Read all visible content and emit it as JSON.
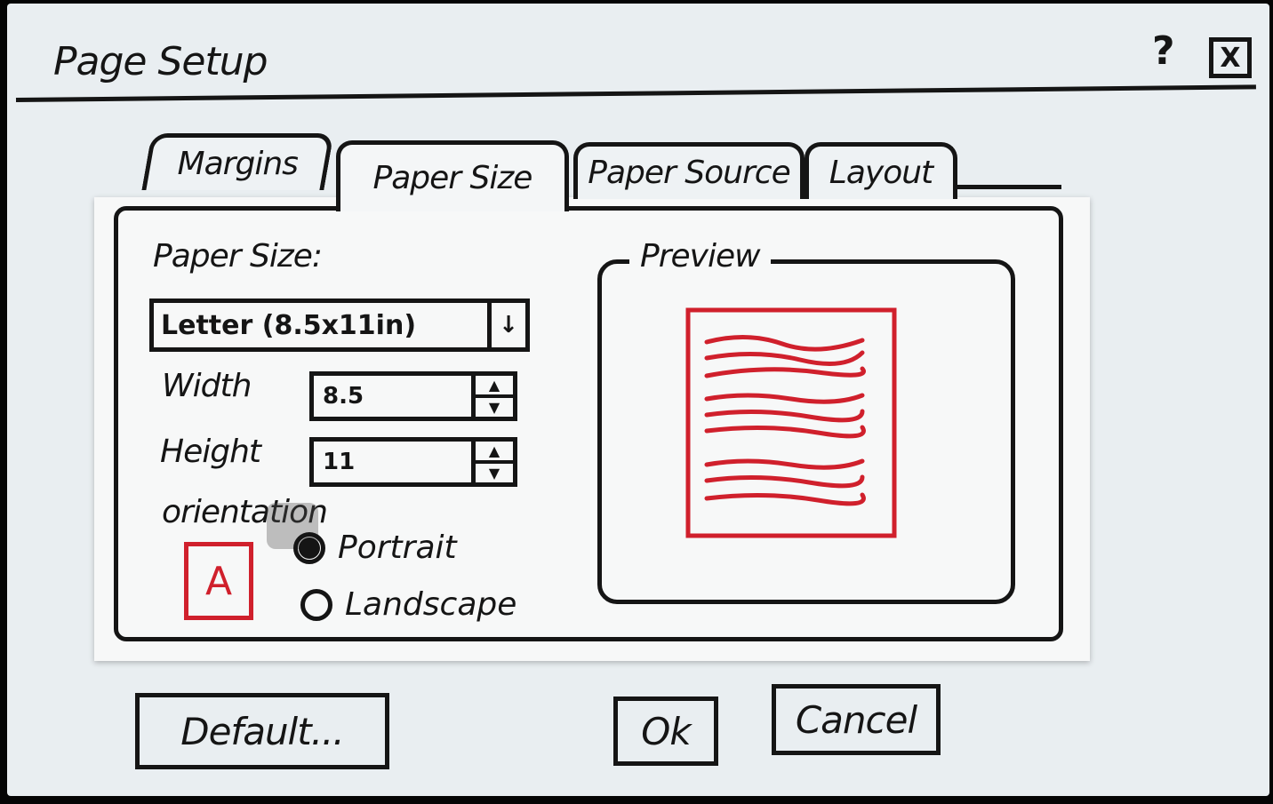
{
  "dialog": {
    "title": "Page Setup",
    "help_label": "?",
    "close_label": "X"
  },
  "tabs": [
    {
      "label": "Margins",
      "active": false
    },
    {
      "label": "Paper Size",
      "active": true
    },
    {
      "label": "Paper Source",
      "active": false
    },
    {
      "label": "Layout",
      "active": false
    }
  ],
  "paper_size": {
    "label": "Paper Size:",
    "selected": "Letter (8.5x11in)",
    "dropdown_icon": "arrow-down"
  },
  "width": {
    "label": "Width",
    "value": "8.5"
  },
  "height": {
    "label": "Height",
    "value": "11"
  },
  "orientation": {
    "label": "orientation",
    "icon_letter": "A",
    "options": [
      {
        "label": "Portrait",
        "selected": true
      },
      {
        "label": "Landscape",
        "selected": false
      }
    ]
  },
  "preview": {
    "label": "Preview"
  },
  "buttons": {
    "default": "Default...",
    "ok": "Ok",
    "cancel": "Cancel"
  },
  "colors": {
    "ink": "#151515",
    "accent_red": "#d0202c",
    "paper": "#e9eef1"
  }
}
